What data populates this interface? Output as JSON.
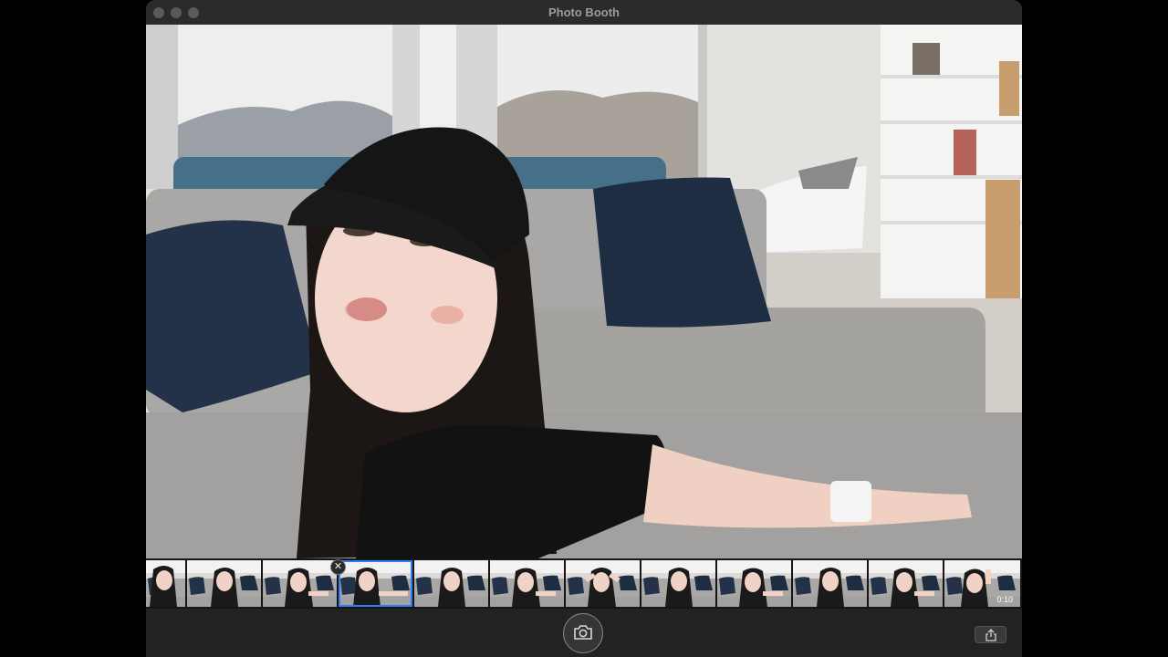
{
  "window": {
    "title": "Photo Booth"
  },
  "thumbnails": [
    {
      "selected": false,
      "variant": 0
    },
    {
      "selected": false,
      "variant": 1
    },
    {
      "selected": false,
      "variant": 2
    },
    {
      "selected": true,
      "variant": 3
    },
    {
      "selected": false,
      "variant": 1
    },
    {
      "selected": false,
      "variant": 2
    },
    {
      "selected": false,
      "variant": 4
    },
    {
      "selected": false,
      "variant": 1
    },
    {
      "selected": false,
      "variant": 2
    },
    {
      "selected": false,
      "variant": 1
    },
    {
      "selected": false,
      "variant": 2
    },
    {
      "selected": false,
      "variant": 5,
      "duration": "0:10"
    }
  ],
  "toolbar": {
    "shutter_icon": "camera-icon",
    "share_icon": "share-icon"
  },
  "colors": {
    "selection": "#2f7ef5",
    "window_bg": "#1f1f1f",
    "titlebar": "#2b2b2b"
  }
}
